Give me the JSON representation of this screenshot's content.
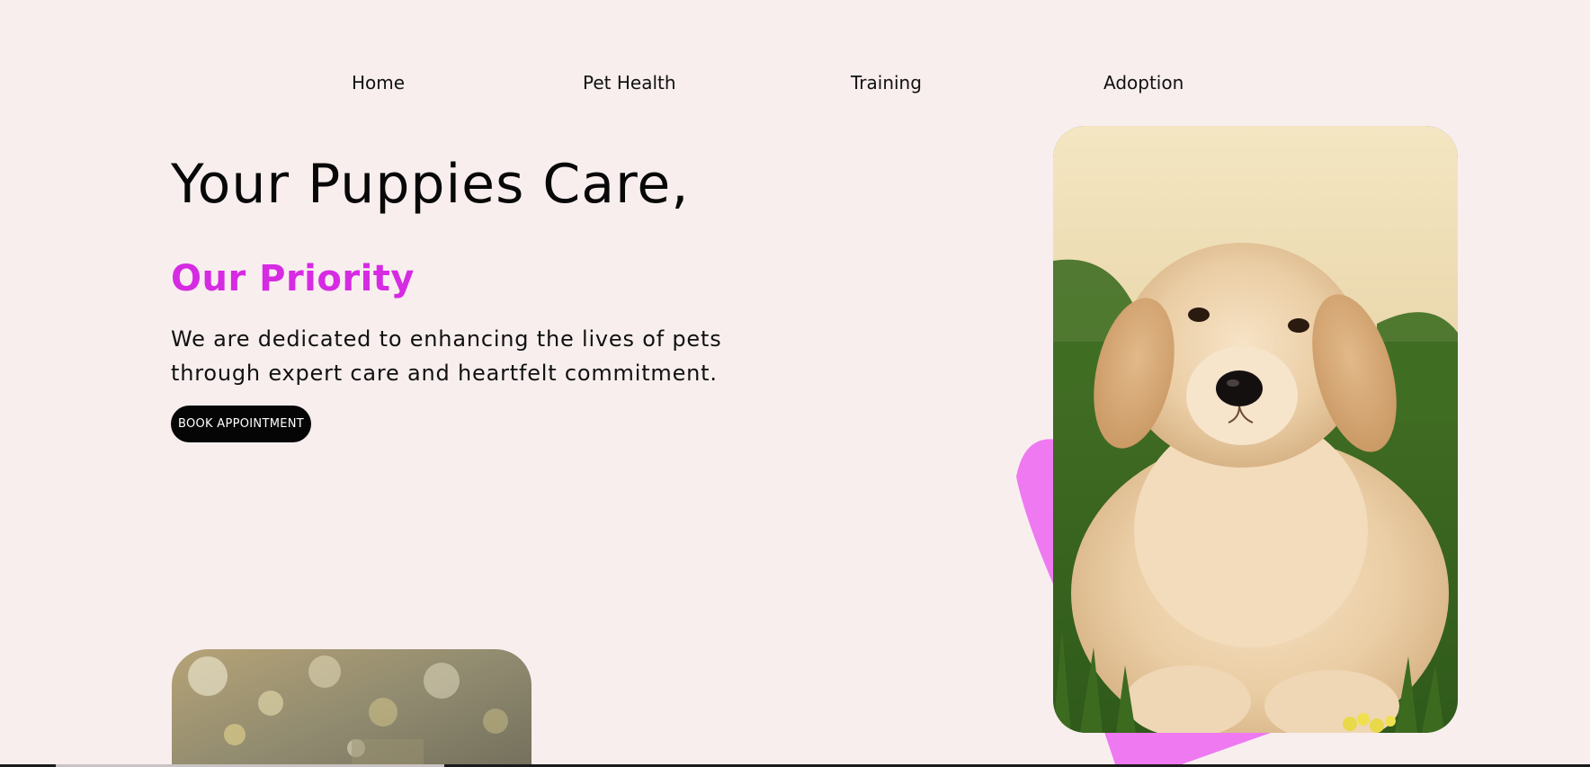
{
  "nav": {
    "items": [
      {
        "label": "Home"
      },
      {
        "label": "Pet Health"
      },
      {
        "label": "Training"
      },
      {
        "label": "Adoption"
      }
    ]
  },
  "hero": {
    "title": "Your Puppies Care,",
    "subtitle": "Our Priority",
    "description": "We are dedicated to enhancing the lives of pets through expert care and heartfelt commitment.",
    "cta_label": "BOOK APPOINTMENT"
  },
  "colors": {
    "background": "#f8eeee",
    "accent": "#d62ae3",
    "decoration": "#ee79f1",
    "button": "#050505"
  },
  "images": {
    "hero_image": "golden-retriever-puppy-photo",
    "bottom_image": "bokeh-outdoor-photo"
  }
}
